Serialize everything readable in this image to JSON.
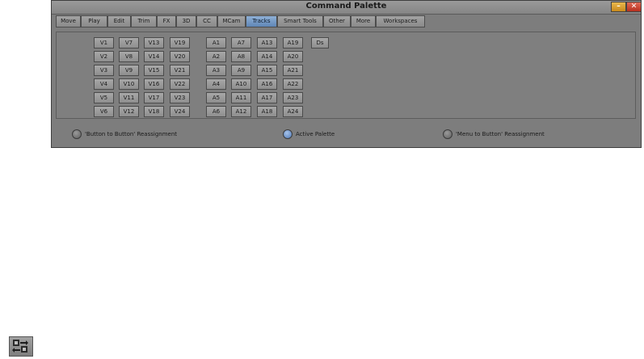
{
  "window": {
    "title": "Command Palette",
    "minimize": "–",
    "close": "✕"
  },
  "tabs": [
    "Move",
    "Play",
    "Edit",
    "Trim",
    "FX",
    "3D",
    "CC",
    "MCam",
    "Tracks",
    "Smart Tools",
    "Other",
    "More",
    "Workspaces"
  ],
  "active_tab": "Tracks",
  "video_tracks": [
    [
      "V1",
      "V2",
      "V3",
      "V4",
      "V5",
      "V6"
    ],
    [
      "V7",
      "V8",
      "V9",
      "V10",
      "V11",
      "V12"
    ],
    [
      "V13",
      "V14",
      "V15",
      "V16",
      "V17",
      "V18"
    ],
    [
      "V19",
      "V20",
      "V21",
      "V22",
      "V23",
      "V24"
    ]
  ],
  "audio_tracks": [
    [
      "A1",
      "A2",
      "A3",
      "A4",
      "A5",
      "A6"
    ],
    [
      "A7",
      "A8",
      "A9",
      "A10",
      "A11",
      "A12"
    ],
    [
      "A13",
      "A14",
      "A15",
      "A16",
      "A17",
      "A18"
    ],
    [
      "A19",
      "A20",
      "A21",
      "A22",
      "A23",
      "A24"
    ]
  ],
  "extra_button": "Ds",
  "radios": [
    {
      "label": "'Button to Button' Reassignment",
      "selected": false
    },
    {
      "label": "Active Palette",
      "selected": true
    },
    {
      "label": "'Menu to Button' Reassignment",
      "selected": false
    }
  ],
  "colors": {
    "accent": "#5f86b6",
    "panel": "#7f7f7f"
  }
}
